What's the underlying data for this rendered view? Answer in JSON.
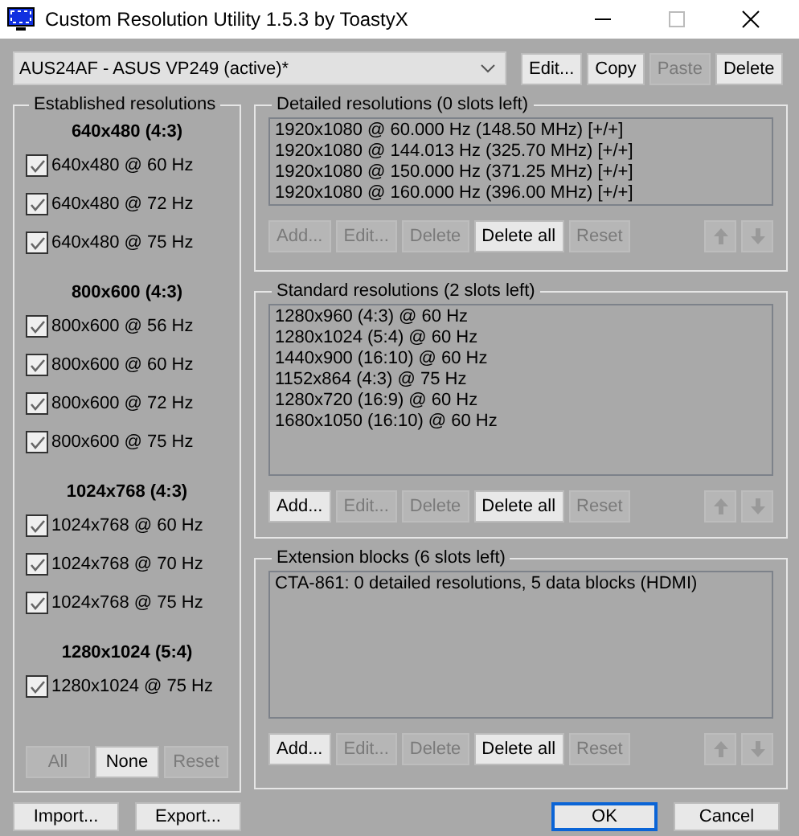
{
  "window": {
    "title": "Custom Resolution Utility 1.5.3 by ToastyX"
  },
  "display_select": {
    "value": "AUS24AF - ASUS VP249 (active)*"
  },
  "top_buttons": [
    {
      "label": "Edit...",
      "disabled": false
    },
    {
      "label": "Copy",
      "disabled": false
    },
    {
      "label": "Paste",
      "disabled": true
    },
    {
      "label": "Delete",
      "disabled": false
    }
  ],
  "established": {
    "title": "Established resolutions",
    "groups": [
      {
        "heading": "640x480 (4:3)",
        "items": [
          {
            "label": "640x480 @ 60 Hz",
            "checked": true
          },
          {
            "label": "640x480 @ 72 Hz",
            "checked": true
          },
          {
            "label": "640x480 @ 75 Hz",
            "checked": true
          }
        ]
      },
      {
        "heading": "800x600 (4:3)",
        "items": [
          {
            "label": "800x600 @ 56 Hz",
            "checked": true
          },
          {
            "label": "800x600 @ 60 Hz",
            "checked": true
          },
          {
            "label": "800x600 @ 72 Hz",
            "checked": true
          },
          {
            "label": "800x600 @ 75 Hz",
            "checked": true
          }
        ]
      },
      {
        "heading": "1024x768 (4:3)",
        "items": [
          {
            "label": "1024x768 @ 60 Hz",
            "checked": true
          },
          {
            "label": "1024x768 @ 70 Hz",
            "checked": true
          },
          {
            "label": "1024x768 @ 75 Hz",
            "checked": true
          }
        ]
      },
      {
        "heading": "1280x1024 (5:4)",
        "items": [
          {
            "label": "1280x1024 @ 75 Hz",
            "checked": true
          }
        ]
      }
    ],
    "buttons": [
      {
        "label": "All",
        "disabled": true
      },
      {
        "label": "None",
        "disabled": false
      },
      {
        "label": "Reset",
        "disabled": true
      }
    ]
  },
  "sections": [
    {
      "title": "Detailed resolutions (0 slots left)",
      "rows": [
        "1920x1080 @ 60.000 Hz (148.50 MHz) [+/+]",
        "1920x1080 @ 144.013 Hz (325.70 MHz) [+/+]",
        "1920x1080 @ 150.000 Hz (371.25 MHz) [+/+]",
        "1920x1080 @ 160.000 Hz (396.00 MHz) [+/+]"
      ],
      "buttons": [
        {
          "label": "Add...",
          "disabled": true
        },
        {
          "label": "Edit...",
          "disabled": true
        },
        {
          "label": "Delete",
          "disabled": true
        },
        {
          "label": "Delete all",
          "disabled": false
        },
        {
          "label": "Reset",
          "disabled": true
        }
      ],
      "move_up_disabled": true,
      "move_down_disabled": true
    },
    {
      "title": "Standard resolutions (2 slots left)",
      "rows": [
        "1280x960 (4:3) @ 60 Hz",
        "1280x1024 (5:4) @ 60 Hz",
        "1440x900 (16:10) @ 60 Hz",
        "1152x864 (4:3) @ 75 Hz",
        "1280x720 (16:9) @ 60 Hz",
        "1680x1050 (16:10) @ 60 Hz"
      ],
      "buttons": [
        {
          "label": "Add...",
          "disabled": false
        },
        {
          "label": "Edit...",
          "disabled": true
        },
        {
          "label": "Delete",
          "disabled": true
        },
        {
          "label": "Delete all",
          "disabled": false
        },
        {
          "label": "Reset",
          "disabled": true
        }
      ],
      "move_up_disabled": true,
      "move_down_disabled": true
    },
    {
      "title": "Extension blocks (6 slots left)",
      "rows": [
        "CTA-861: 0 detailed resolutions, 5 data blocks (HDMI)"
      ],
      "buttons": [
        {
          "label": "Add...",
          "disabled": false
        },
        {
          "label": "Edit...",
          "disabled": true
        },
        {
          "label": "Delete",
          "disabled": true
        },
        {
          "label": "Delete all",
          "disabled": false
        },
        {
          "label": "Reset",
          "disabled": true
        }
      ],
      "move_up_disabled": true,
      "move_down_disabled": true
    }
  ],
  "bottom_left_buttons": [
    {
      "label": "Import...",
      "default": false
    },
    {
      "label": "Export...",
      "default": false
    }
  ],
  "bottom_right_buttons": [
    {
      "label": "OK",
      "default": true
    },
    {
      "label": "Cancel",
      "default": false
    }
  ]
}
